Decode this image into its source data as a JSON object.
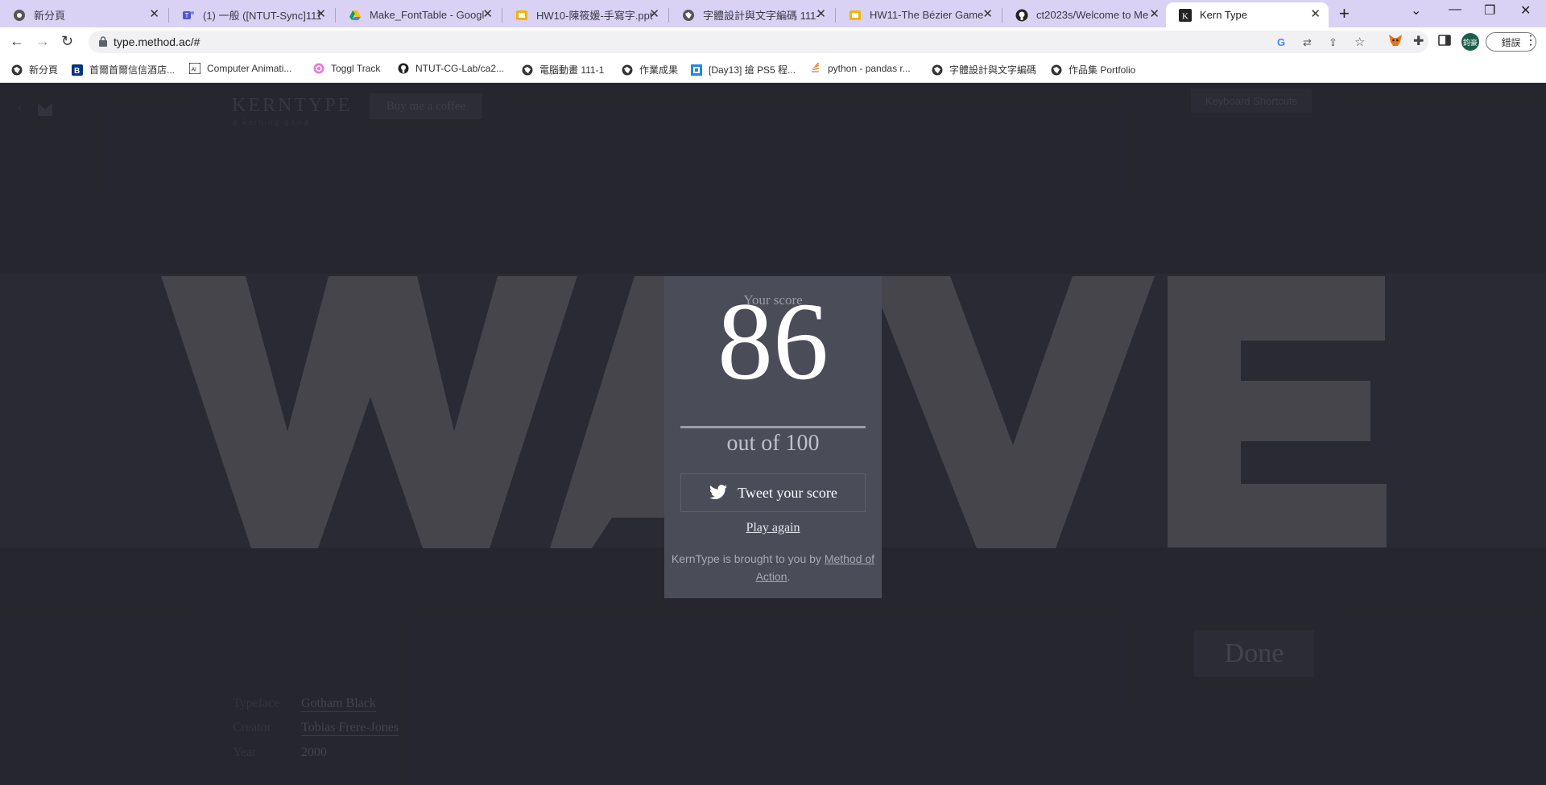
{
  "browser": {
    "tabs": [
      {
        "title": "新分頁",
        "icon": "chrome-icon"
      },
      {
        "title": "(1) 一般 ([NTUT-Sync]111",
        "icon": "teams-icon"
      },
      {
        "title": "Make_FontTable - Googl",
        "icon": "google-drive-icon"
      },
      {
        "title": "HW10-陳筱媛-手寫字.ppt",
        "icon": "slides-icon"
      },
      {
        "title": "字體設計與文字編碼 111-",
        "icon": "globe-icon"
      },
      {
        "title": "HW11-The Bézier Game",
        "icon": "slides-icon"
      },
      {
        "title": "ct2023s/Welcome to Me",
        "icon": "github-icon"
      },
      {
        "title": "Kern Type",
        "icon": "kerntype-k-icon",
        "active": true
      }
    ],
    "url": "type.method.ac/#",
    "profile_text": "鈞豪",
    "error_button": "錯誤",
    "bookmarks": [
      {
        "label": "新分頁",
        "icon": "globe-icon"
      },
      {
        "label": "首爾首爾信信酒店...",
        "icon": "booking-icon"
      },
      {
        "label": "Computer Animati...",
        "icon": "illustrator-icon"
      },
      {
        "label": "Toggl Track",
        "icon": "toggl-icon"
      },
      {
        "label": "NTUT-CG-Lab/ca2...",
        "icon": "github-icon"
      },
      {
        "label": "電腦動畫 111-1",
        "icon": "globe-icon"
      },
      {
        "label": "作業成果",
        "icon": "globe-icon"
      },
      {
        "label": "[Day13] 搶 PS5 程...",
        "icon": "ithome-icon"
      },
      {
        "label": "python - pandas r...",
        "icon": "stackoverflow-icon"
      },
      {
        "label": "字體設計與文字編碼",
        "icon": "globe-icon"
      },
      {
        "label": "作品集 Portfolio",
        "icon": "globe-icon"
      }
    ]
  },
  "site": {
    "brand": "KERNTYPE",
    "brand_sub": "a kerning game",
    "coffee_button": "Buy me a coffee",
    "keyboard_shortcuts": "Keyboard Shortcuts",
    "word": "WAVE",
    "info": {
      "typeface_label": "Typeface",
      "typeface_value": "Gotham Black",
      "creator_label": "Creator",
      "creator_value": "Tobias Frere-Jones",
      "year_label": "Year",
      "year_value": "2000"
    },
    "done_button": "Done"
  },
  "modal": {
    "label": "Your score",
    "score": "86",
    "out_of": "out of 100",
    "tweet": "Tweet your score",
    "play_again": "Play again",
    "credit_prefix": "KernType is brought to you by ",
    "credit_link": "Method of Action",
    "credit_suffix": "."
  },
  "colors": {
    "background": "#262630",
    "modal": "#4a4d57",
    "letters": "#4a4a51",
    "tabbar": "#d9d2f4"
  }
}
